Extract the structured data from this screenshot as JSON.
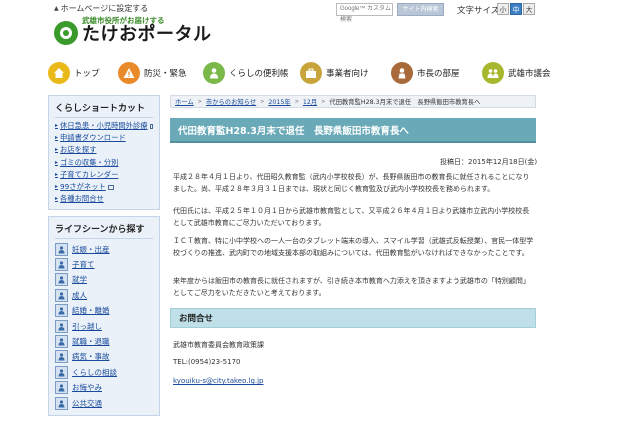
{
  "header": {
    "home_link": "ホームページに設定する",
    "logo_sub": "武雄市役所がお届けする",
    "logo_main": "たけおポータル",
    "search_placeholder": "Google™ カスタム検索",
    "search_button": "サイト内検索",
    "font_size_label": "文字サイズ",
    "font_small": "小",
    "font_mid": "中",
    "font_large": "大"
  },
  "nav": [
    {
      "label": "トップ",
      "icon": "home-icon",
      "color": "#e9b919"
    },
    {
      "label": "防災・緊急",
      "icon": "warning-icon",
      "color": "#e98a2a"
    },
    {
      "label": "くらしの便利帳",
      "icon": "person-icon",
      "color": "#7bb84a"
    },
    {
      "label": "事業者向け",
      "icon": "briefcase-icon",
      "color": "#c9a43a"
    },
    {
      "label": "市長の部屋",
      "icon": "mayor-icon",
      "color": "#a86a3a"
    },
    {
      "label": "武雄市議会",
      "icon": "council-icon",
      "color": "#a7b72e"
    }
  ],
  "sidebar": {
    "shortcut_title": "くらしショートカット",
    "shortcuts": [
      {
        "label": "休日急患・小児時間外診療",
        "external": true
      },
      {
        "label": "申請書ダウンロード",
        "external": false
      },
      {
        "label": "お店を探す",
        "external": false
      },
      {
        "label": "ゴミの収集・分別",
        "external": false
      },
      {
        "label": "子育てカレンダー",
        "external": false
      },
      {
        "label": "99さがネット",
        "external": true
      },
      {
        "label": "各種お問合せ",
        "external": false
      }
    ],
    "lifescene_title": "ライフシーンから探す",
    "lifescenes": [
      "妊娠・出産",
      "子育て",
      "就学",
      "成人",
      "結婚・離婚",
      "引っ越し",
      "就職・退職",
      "病気・事故",
      "くらしの相談",
      "お悔やみ",
      "公共交通"
    ]
  },
  "breadcrumb": {
    "items": [
      "ホーム",
      "市からのお知らせ",
      "2015年",
      "12月"
    ],
    "current": "代田教育監H28.3月末で退任　長野県飯田市教育長へ"
  },
  "article": {
    "title": "代田教育監H28.3月末で退任　長野県飯田市教育長へ",
    "posted": "投稿日：2015年12月18日(金)",
    "paragraphs": [
      "平成２８年４月１日より、代田昭久教育監（武内小学校校長）が、長野県飯田市の教育長に就任されることになりました。尚、平成２８年３月３１日までは、現状と同じく教育監及び武内小学校校長を務められます。",
      "代田氏には、平成２５年１０月１日から武雄市教育監として、又平成２６年４月１日より武雄市立武内小学校校長として武雄市教育にご尽力いただいております。",
      "ＩＣＴ教育、特に小中学校への一人一台のタブレット端末の導入、スマイル学習（武雄式反転授業）、官民一体型学校づくりの推進、武内町での地域支援本部の取組みについては、代田教育監がいなければできなかったことです。",
      "来年度からは飯田市の教育長に就任されますが、引き続き本市教育へ力添えを頂きますよう武雄市の「特別顧問」としてご尽力をいただきたいと考えております。"
    ],
    "contact_title": "お問合せ",
    "contact_dept": "武雄市教育委員会教育政策課",
    "contact_tel": "TEL:(0954)23-5170",
    "contact_email": "kyouiku-s@city.takeo.lg.jp"
  }
}
